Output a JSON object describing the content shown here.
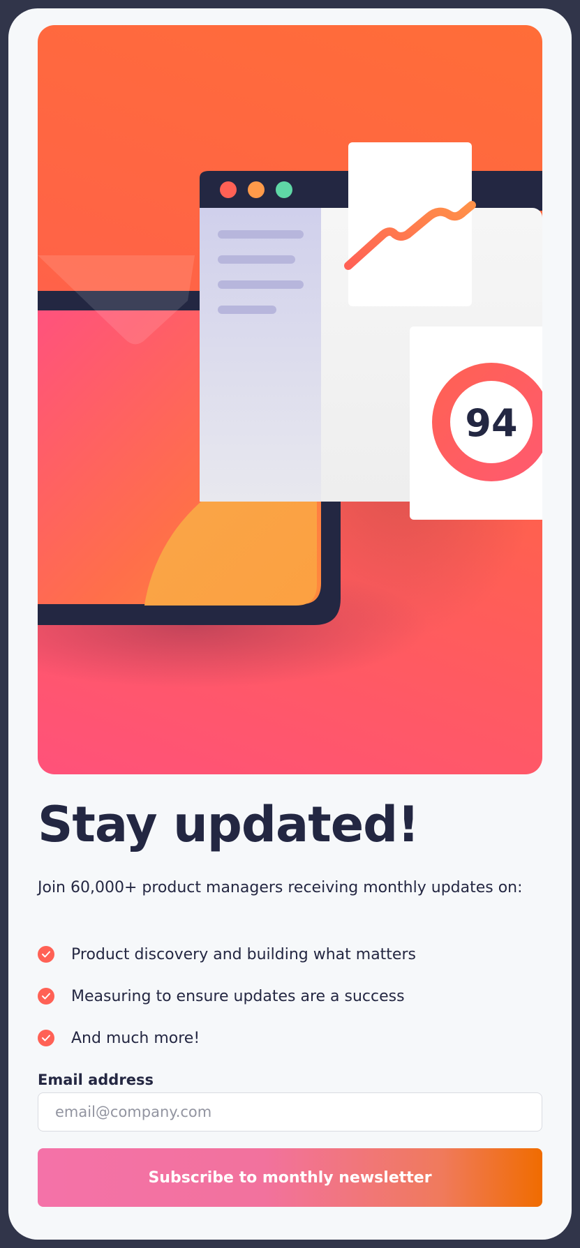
{
  "hero": {
    "score": "94",
    "window_dot_colors": [
      "#ff6155",
      "#ff9a4a",
      "#5fd7a6"
    ]
  },
  "content": {
    "headline": "Stay updated!",
    "intro": "Join 60,000+ product managers receiving monthly updates on:",
    "features": [
      "Product discovery and building what matters",
      "Measuring to ensure updates are a success",
      "And much more!"
    ]
  },
  "form": {
    "email_label": "Email address",
    "email_placeholder": "email@company.com",
    "email_value": "",
    "submit_label": "Subscribe to monthly newsletter"
  },
  "colors": {
    "dark_navy": "#242742",
    "tomato": "#ff6155",
    "background": "#f6f8fa",
    "page_frame": "#31354a"
  }
}
